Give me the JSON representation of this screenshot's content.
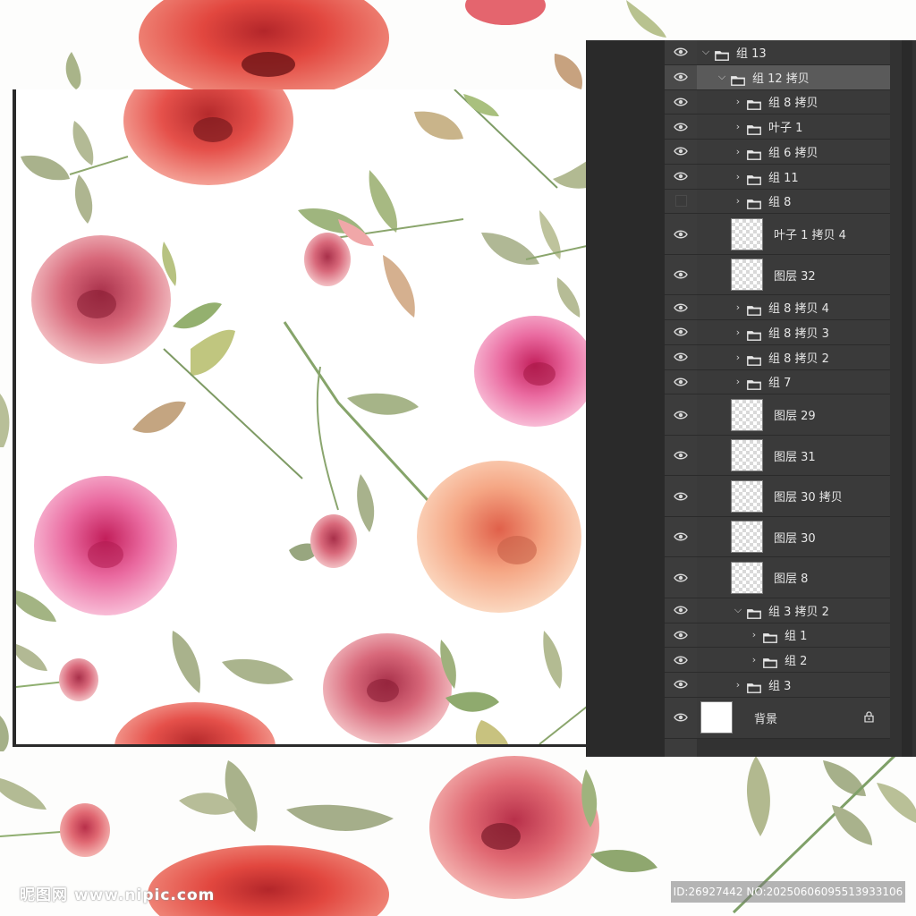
{
  "layers_panel": {
    "rows": [
      {
        "label": "组 13",
        "kind": "folder",
        "indent": 0,
        "expanded": true,
        "visible": true
      },
      {
        "label": "组 12 拷贝",
        "kind": "folder",
        "indent": 1,
        "expanded": true,
        "visible": true,
        "selected": true
      },
      {
        "label": "组 8 拷贝",
        "kind": "folder",
        "indent": 2,
        "expanded": false,
        "visible": true
      },
      {
        "label": "叶子 1",
        "kind": "folder",
        "indent": 2,
        "expanded": false,
        "visible": true
      },
      {
        "label": "组 6 拷贝",
        "kind": "folder",
        "indent": 2,
        "expanded": false,
        "visible": true
      },
      {
        "label": "组 11",
        "kind": "folder",
        "indent": 2,
        "expanded": false,
        "visible": true
      },
      {
        "label": "组 8",
        "kind": "folder",
        "indent": 2,
        "expanded": false,
        "visible": false
      },
      {
        "label": "叶子 1 拷贝 4",
        "kind": "layer",
        "indent": 2,
        "visible": true
      },
      {
        "label": "图层 32",
        "kind": "layer",
        "indent": 2,
        "visible": true
      },
      {
        "label": "组 8 拷贝 4",
        "kind": "folder",
        "indent": 2,
        "expanded": false,
        "visible": true
      },
      {
        "label": "组 8 拷贝 3",
        "kind": "folder",
        "indent": 2,
        "expanded": false,
        "visible": true
      },
      {
        "label": "组 8 拷贝 2",
        "kind": "folder",
        "indent": 2,
        "expanded": false,
        "visible": true
      },
      {
        "label": "组 7",
        "kind": "folder",
        "indent": 2,
        "expanded": false,
        "visible": true
      },
      {
        "label": "图层 29",
        "kind": "layer",
        "indent": 2,
        "visible": true
      },
      {
        "label": "图层 31",
        "kind": "layer",
        "indent": 2,
        "visible": true
      },
      {
        "label": "图层 30 拷贝",
        "kind": "layer",
        "indent": 2,
        "visible": true
      },
      {
        "label": "图层 30",
        "kind": "layer",
        "indent": 2,
        "visible": true
      },
      {
        "label": "图层 8",
        "kind": "layer",
        "indent": 2,
        "visible": true
      },
      {
        "label": "组 3 拷贝 2",
        "kind": "folder",
        "indent": 2,
        "expanded": true,
        "visible": true
      },
      {
        "label": "组 1",
        "kind": "folder",
        "indent": 3,
        "expanded": false,
        "visible": true
      },
      {
        "label": "组 2",
        "kind": "folder",
        "indent": 3,
        "expanded": false,
        "visible": true
      },
      {
        "label": "组 3",
        "kind": "folder",
        "indent": 2,
        "expanded": false,
        "visible": true
      },
      {
        "label": "背景",
        "kind": "background",
        "indent": 0,
        "visible": true,
        "locked": true
      }
    ]
  },
  "watermark": {
    "left_text": "昵图网 www.nipic.com",
    "right_text": "ID:26927442 NO:20250606095513933106"
  },
  "colors": {
    "panel_bg": "#323232",
    "row_bg": "#3a3a3a",
    "row_selected_bg": "#5a5a5a",
    "rose_red": "#e8504a",
    "rose_pink": "#e86a9a",
    "rose_peach": "#f5b48a",
    "leaf_green": "#a9b68a"
  },
  "icons": [
    "eye-icon",
    "folder-icon",
    "chevron-right-icon",
    "chevron-down-icon",
    "lock-icon"
  ]
}
